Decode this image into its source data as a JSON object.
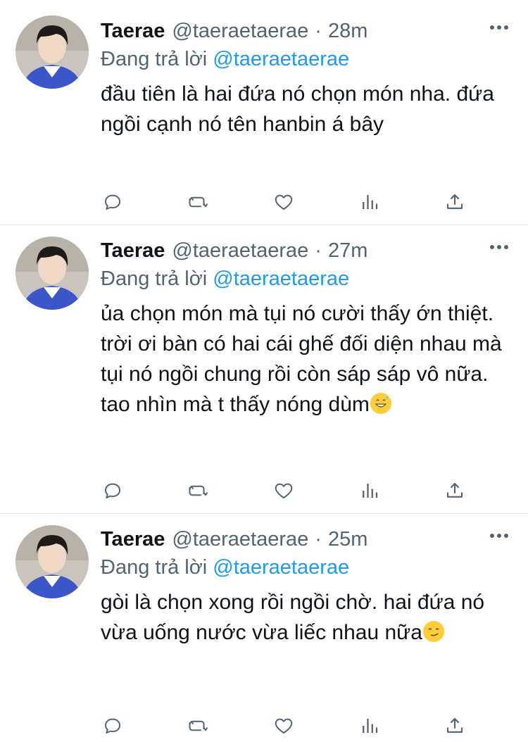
{
  "tweets": [
    {
      "name": "Taerae",
      "handle": "@taeraetaerae",
      "separator": "·",
      "time": "28m",
      "reply_prefix": "Đang trả lời",
      "reply_to": "@taeraetaerae",
      "text": "đầu tiên là hai đứa nó chọn món nha. đứa ngồi cạnh nó tên hanbin á bây",
      "emoji": ""
    },
    {
      "name": "Taerae",
      "handle": "@taeraetaerae",
      "separator": "·",
      "time": "27m",
      "reply_prefix": "Đang trả lời",
      "reply_to": "@taeraetaerae",
      "text": "ủa chọn món mà tụi nó cười thấy ớn thiệt. trời ơi bàn có hai cái ghế đối diện nhau mà tụi nó ngồi chung rồi còn sáp sáp vô nữa. tao nhìn mà t thấy nóng dùm",
      "emoji": "grinning-sweat-emoji"
    },
    {
      "name": "Taerae",
      "handle": "@taeraetaerae",
      "separator": "·",
      "time": "25m",
      "reply_prefix": "Đang trả lời",
      "reply_to": "@taeraetaerae",
      "text": "gòi là chọn xong rồi ngồi chờ. hai đứa nó vừa uống nước vừa liếc nhau nữa",
      "emoji": "smirk-emoji"
    }
  ],
  "actions": [
    "reply-icon",
    "retweet-icon",
    "like-icon",
    "analytics-icon",
    "share-icon"
  ],
  "colors": {
    "text": "#0f1419",
    "secondary": "#536471",
    "link": "#1d9bf0",
    "divider": "#e1e8ed"
  }
}
